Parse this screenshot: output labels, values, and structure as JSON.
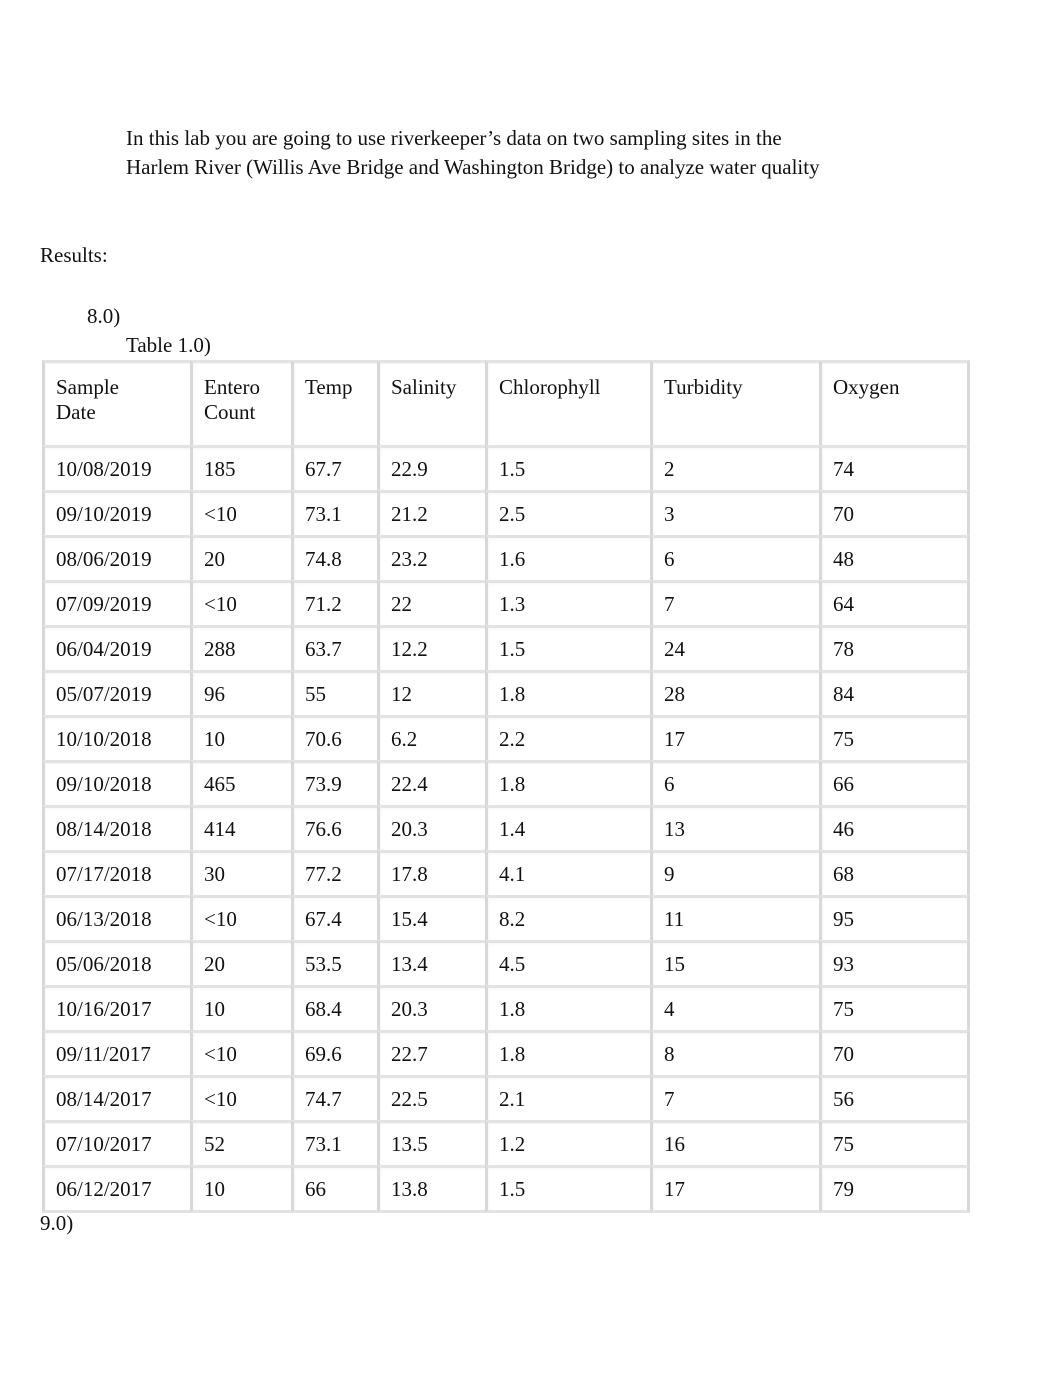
{
  "intro": {
    "text": "In this lab you are going to use riverkeeper’s data on two sampling sites in the Harlem River (Willis Ave Bridge and Washington Bridge) to analyze water quality"
  },
  "results_label": "Results:",
  "question_8": "8.0)",
  "table_caption": "Table 1.0)",
  "question_9": "9.0)",
  "table": {
    "headers": [
      [
        "Sample",
        "Date"
      ],
      [
        "Entero",
        "Count"
      ],
      [
        "Temp",
        ""
      ],
      [
        "Salinity",
        ""
      ],
      [
        "Chlorophyll",
        ""
      ],
      [
        "Turbidity",
        ""
      ],
      [
        "Oxygen",
        ""
      ]
    ],
    "rows": [
      [
        "10/08/2019",
        "185",
        "67.7",
        "22.9",
        "1.5",
        "2",
        "74"
      ],
      [
        "09/10/2019",
        "<10",
        "73.1",
        "21.2",
        "2.5",
        "3",
        "70"
      ],
      [
        "08/06/2019",
        "20",
        "74.8",
        "23.2",
        "1.6",
        "6",
        "48"
      ],
      [
        "07/09/2019",
        "<10",
        "71.2",
        "22",
        "1.3",
        "7",
        "64"
      ],
      [
        "06/04/2019",
        "288",
        "63.7",
        "12.2",
        "1.5",
        "24",
        "78"
      ],
      [
        "05/07/2019",
        "96",
        "55",
        "12",
        "1.8",
        "28",
        "84"
      ],
      [
        "10/10/2018",
        "10",
        "70.6",
        "6.2",
        "2.2",
        "17",
        "75"
      ],
      [
        "09/10/2018",
        "465",
        "73.9",
        "22.4",
        "1.8",
        "6",
        "66"
      ],
      [
        "08/14/2018",
        "414",
        "76.6",
        "20.3",
        "1.4",
        "13",
        "46"
      ],
      [
        "07/17/2018",
        "30",
        "77.2",
        "17.8",
        "4.1",
        "9",
        "68"
      ],
      [
        "06/13/2018",
        "<10",
        "67.4",
        "15.4",
        "8.2",
        "11",
        "95"
      ],
      [
        "05/06/2018",
        "20",
        "53.5",
        "13.4",
        "4.5",
        "15",
        "93"
      ],
      [
        "10/16/2017",
        "10",
        "68.4",
        "20.3",
        "1.8",
        "4",
        "75"
      ],
      [
        "09/11/2017",
        "<10",
        "69.6",
        "22.7",
        "1.8",
        "8",
        "70"
      ],
      [
        "08/14/2017",
        "<10",
        "74.7",
        "22.5",
        "2.1",
        "7",
        "56"
      ],
      [
        "07/10/2017",
        "52",
        "73.1",
        "13.5",
        "1.2",
        "16",
        "75"
      ],
      [
        "06/12/2017",
        "10",
        "66",
        "13.8",
        "1.5",
        "17",
        "79"
      ]
    ]
  }
}
